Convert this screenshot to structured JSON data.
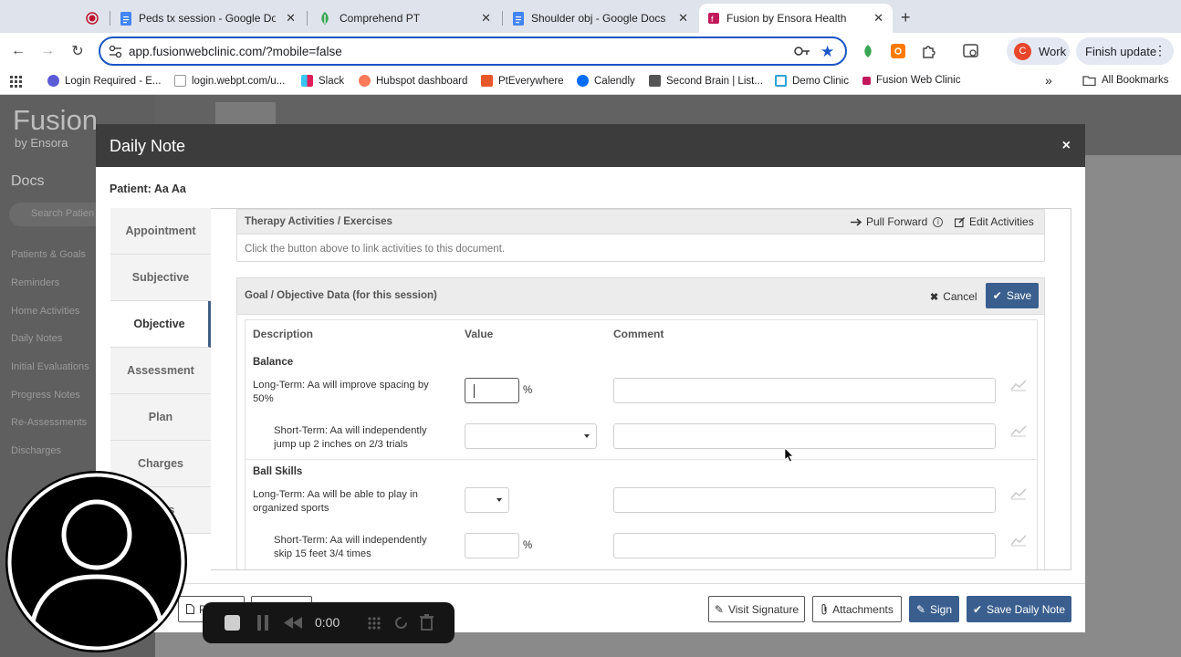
{
  "browser": {
    "tabs": [
      {
        "title": "",
        "icon": "record-icon"
      },
      {
        "title": "Peds tx session - Google Doc",
        "icon": "google-docs-icon"
      },
      {
        "title": "Comprehend PT",
        "icon": "comprehend-pt-icon"
      },
      {
        "title": "Shoulder obj - Google Docs",
        "icon": "google-docs-icon"
      },
      {
        "title": "Fusion by Ensora Health",
        "icon": "fusion-icon",
        "active": true
      }
    ],
    "new_tab": "+",
    "url": "app.fusionwebclinic.com/?mobile=false",
    "profile_label": "Work",
    "profile_initial": "C",
    "update_label": "Finish update",
    "accent": "#1a56c5"
  },
  "bookmarks": {
    "items": [
      {
        "label": "Login Required - E...",
        "color": "#5b5bd6"
      },
      {
        "label": "login.webpt.com/u...",
        "color": "#c9c9c9"
      },
      {
        "label": "Slack",
        "color": "#e01e5a"
      },
      {
        "label": "Hubspot dashboard",
        "color": "#ff7a59"
      },
      {
        "label": "PtEverywhere",
        "color": "#e8572a"
      },
      {
        "label": "Calendly",
        "color": "#006bff"
      },
      {
        "label": "Second Brain | List...",
        "color": "#555555"
      },
      {
        "label": "Demo Clinic",
        "color": "#2aa3d6"
      },
      {
        "label": "Fusion Web Clinic",
        "color": "#c2185b"
      }
    ],
    "more": "»",
    "all_label": "All Bookmarks"
  },
  "app": {
    "logo": "Fusion",
    "logo_sub": "by Ensora",
    "section": "Docs",
    "search_placeholder": "Search Patien",
    "sidebar_links": [
      "Patients & Goals",
      "Reminders",
      "Home Activities",
      "Daily Notes",
      "Initial Evaluations",
      "Progress Notes",
      "Re-Assessments",
      "Discharges"
    ]
  },
  "modal": {
    "title": "Daily Note",
    "close": "×",
    "patient_label": "Patient: Aa Aa",
    "nav": [
      "Appointment",
      "Subjective",
      "Objective",
      "Assessment",
      "Plan",
      "Charges",
      "ators"
    ],
    "therapy": {
      "title": "Therapy Activities / Exercises",
      "pull_forward": "Pull Forward",
      "edit_activities": "Edit Activities",
      "hint": "Click the button above to link activities to this document."
    },
    "goal_panel": {
      "title": "Goal / Objective Data (for this session)",
      "cancel": "Cancel",
      "save": "Save",
      "columns": [
        "Description",
        "Value",
        "Comment"
      ],
      "sections": [
        {
          "name": "Balance",
          "rows": [
            {
              "desc": [
                "Long-Term: Aa will improve spacing by",
                "50%"
              ],
              "unit": "%",
              "value": ""
            },
            {
              "desc": [
                "Short-Term: Aa will independently",
                "jump up 2 inches on 2/3 trials"
              ],
              "unit": "",
              "value": ""
            }
          ]
        },
        {
          "name": "Ball Skills",
          "rows": [
            {
              "desc": [
                "Long-Term: Aa will be able to play in",
                "organized sports"
              ],
              "unit": "",
              "value": ""
            },
            {
              "desc": [
                "Short-Term: Aa will independently",
                "skip 15 feet 3/4 times"
              ],
              "unit": "%",
              "value": ""
            }
          ]
        }
      ]
    },
    "footer": {
      "left_btn": "P",
      "visit_signature": "Visit Signature",
      "attachments": "Attachments",
      "sign": "Sign",
      "save_daily_note": "Save Daily Note"
    },
    "primary_color": "#3a5f8e"
  },
  "recorder": {
    "timer": "0:00"
  }
}
